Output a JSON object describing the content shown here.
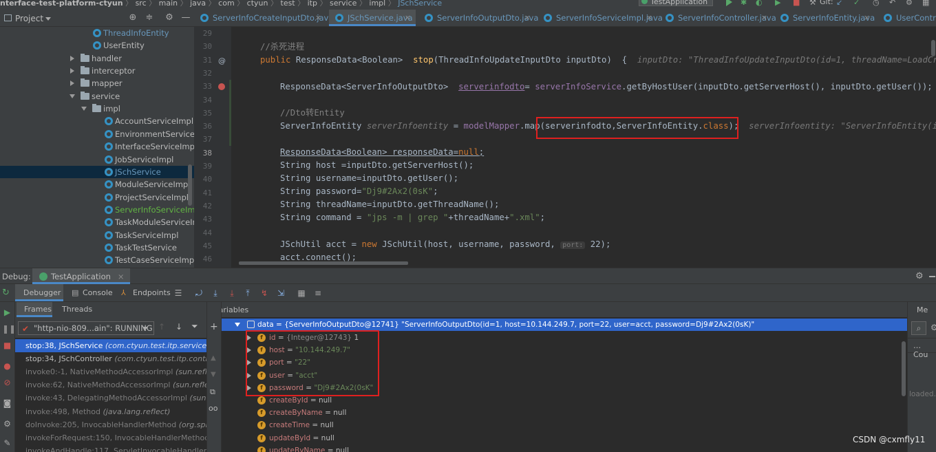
{
  "breadcrumbs": [
    "nterface-test-platform-ctyun",
    "src",
    "main",
    "java",
    "com",
    "ctyun",
    "test",
    "itp",
    "service",
    "impl",
    "JSchService"
  ],
  "run_config": "TestApplication",
  "vcs_label": "Git:",
  "project_panel": {
    "title": "Project",
    "tree": [
      {
        "label": "ThreadInfoEntity",
        "kind": "class",
        "color": "blue"
      },
      {
        "label": "UserEntity",
        "kind": "class",
        "color": "normal"
      },
      {
        "label": "handler",
        "kind": "folder",
        "expanded": false
      },
      {
        "label": "interceptor",
        "kind": "folder",
        "expanded": false
      },
      {
        "label": "mapper",
        "kind": "folder",
        "expanded": false
      },
      {
        "label": "service",
        "kind": "folder",
        "expanded": true
      },
      {
        "label": "impl",
        "kind": "folder",
        "expanded": true
      },
      {
        "label": "AccountServiceImpl",
        "kind": "class",
        "color": "normal"
      },
      {
        "label": "EnvironmentServiceImpl",
        "kind": "class",
        "color": "normal"
      },
      {
        "label": "InterfaceServiceImpl",
        "kind": "class",
        "color": "normal"
      },
      {
        "label": "JobServiceImpl",
        "kind": "class",
        "color": "normal"
      },
      {
        "label": "JSchService",
        "kind": "class",
        "color": "blue",
        "selected": true
      },
      {
        "label": "ModuleServiceImpl",
        "kind": "class",
        "color": "normal"
      },
      {
        "label": "ProjectServiceImpl",
        "kind": "class",
        "color": "normal"
      },
      {
        "label": "ServerInfoServiceImpl",
        "kind": "class",
        "color": "green"
      },
      {
        "label": "TaskModuleServiceImpl",
        "kind": "class",
        "color": "normal"
      },
      {
        "label": "TaskServiceImpl",
        "kind": "class",
        "color": "normal"
      },
      {
        "label": "TaskTestService",
        "kind": "class",
        "color": "normal"
      },
      {
        "label": "TestCaseServiceImpl",
        "kind": "class",
        "color": "normal"
      }
    ]
  },
  "editor_tabs": [
    {
      "label": "ServerInfoCreateInputDto.java",
      "active": false
    },
    {
      "label": "JSchService.java",
      "active": true
    },
    {
      "label": "ServerInfoOutputDto.java",
      "active": false
    },
    {
      "label": "ServerInfoServiceImpl.java",
      "active": false
    },
    {
      "label": "ServerInfoController.java",
      "active": false
    },
    {
      "label": "ServerInfoEntity.java",
      "active": false
    },
    {
      "label": "UserContro",
      "active": false
    }
  ],
  "line_numbers": [
    "29",
    "30",
    "31",
    "32",
    "33",
    "34",
    "35",
    "36",
    "37",
    "38",
    "39",
    "40",
    "41",
    "42",
    "43",
    "44",
    "45",
    "46"
  ],
  "current_line": "38",
  "code": {
    "l30": "//杀死进程",
    "l31": {
      "kw": "public ",
      "type": "ResponseData<Boolean>  ",
      "fn": "stop",
      "rest": "(ThreadInfoUpdateInputDto inputDto)  {",
      "hint": "inputDto: \"ThreadInfoUpdateInputDto(id=1, threadName=LoadCr"
    },
    "l33": {
      "a": "ResponseData<ServerInfoOutputDto>  ",
      "var": "serverinfodto",
      "b": "= ",
      "field": "serverInfoService",
      "c": ".getByHostUser(inputDto.getServerHost(), inputDto.getUser());"
    },
    "l35": "//Dto转Entity",
    "l36": {
      "a": "ServerInfoEntity ",
      "var": "serverInfoentity",
      "b": " = ",
      "field": "modelMapper",
      "c": ".map(serverinfodto,ServerInfoEntity.",
      "kw": "class",
      "d": ");",
      "hint": "serverInfoentity: \"ServerInfoEntity(i"
    },
    "l38": {
      "a": "ResponseData<Boolean> responseData=",
      "kw": "null",
      "b": ";"
    },
    "l39": "String host =inputDto.getServerHost();",
    "l40": "String username=inputDto.getUser();",
    "l41": {
      "a": "String password=",
      "str": "\"Dj9#2Ax2(0sK\"",
      "b": ";"
    },
    "l42": "String threadName=inputDto.getThreadName();",
    "l43": {
      "a": "String command = ",
      "s1": "\"jps -m | grep \"",
      "b": "+threadName+",
      "s2": "\".xml\"",
      "c": ";"
    },
    "l45": {
      "a": "JSchUtil acct = ",
      "kw": "new ",
      "b": "JSchUtil(host, username, password, ",
      "param": "port:",
      "c": " 22);"
    },
    "l46": "acct.connect();"
  },
  "debug": {
    "label": "Debug:",
    "run_tab": "TestApplication",
    "tabs": {
      "debugger": "Debugger",
      "console": "Console",
      "endpoints": "Endpoints"
    },
    "subtabs": {
      "frames": "Frames",
      "threads": "Threads"
    },
    "thread": "\"http-nio-809...ain\": RUNNING",
    "frames": [
      {
        "method": "stop:38, JSchService",
        "cls": "(com.ctyun.test.itp.service.impl)",
        "state": "selected"
      },
      {
        "method": "stop:34, JSchController",
        "cls": "(com.ctyun.test.itp.controller)",
        "state": "normal"
      },
      {
        "method": "invoke0:-1, NativeMethodAccessorImpl",
        "cls": "(sun.reflect)",
        "state": "dim"
      },
      {
        "method": "invoke:62, NativeMethodAccessorImpl",
        "cls": "(sun.reflect)",
        "state": "dim"
      },
      {
        "method": "invoke:43, DelegatingMethodAccessorImpl",
        "cls": "(sun.refle",
        "state": "dim"
      },
      {
        "method": "invoke:498, Method",
        "cls": "(java.lang.reflect)",
        "state": "dim"
      },
      {
        "method": "doInvoke:205, InvocableHandlerMethod",
        "cls": "(org.springf",
        "state": "dim"
      },
      {
        "method": "invokeForRequest:150, InvocableHandlerMethod",
        "cls": "(or",
        "state": "dim"
      },
      {
        "method": "invokeAndHandle:117, ServletInvocableHandlerMeth",
        "cls": "",
        "state": "dim"
      }
    ],
    "variables_title": "Variables",
    "root_var": {
      "name": "data",
      "value": " = {ServerInfoOutputDto@12741} \"ServerInfoOutputDto(id=1, host=10.144.249.7, port=22, user=acct, password=Dj9#2Ax2(0sK)\""
    },
    "fields": [
      {
        "name": "id",
        "eq": " = ",
        "meta": "{Integer@12743} ",
        "value": "1",
        "expandable": true,
        "is_str": false
      },
      {
        "name": "host",
        "eq": " = ",
        "meta": "",
        "value": "\"10.144.249.7\"",
        "expandable": true,
        "is_str": true
      },
      {
        "name": "port",
        "eq": " = ",
        "meta": "",
        "value": "\"22\"",
        "expandable": true,
        "is_str": true
      },
      {
        "name": "user",
        "eq": " = ",
        "meta": "",
        "value": "\"acct\"",
        "expandable": true,
        "is_str": true
      },
      {
        "name": "password",
        "eq": " = ",
        "meta": "",
        "value": "\"Dj9#2Ax2(0sK\"",
        "expandable": true,
        "is_str": true
      },
      {
        "name": "createById",
        "eq": " = ",
        "meta": "",
        "value": "null",
        "expandable": false,
        "is_str": false
      },
      {
        "name": "createByName",
        "eq": " = ",
        "meta": "",
        "value": "null",
        "expandable": false,
        "is_str": false
      },
      {
        "name": "createTime",
        "eq": " = ",
        "meta": "",
        "value": "null",
        "expandable": false,
        "is_str": false
      },
      {
        "name": "updateById",
        "eq": " = ",
        "meta": "",
        "value": "null",
        "expandable": false,
        "is_str": false
      },
      {
        "name": "updateByName",
        "eq": " = ",
        "meta": "",
        "value": "null",
        "expandable": false,
        "is_str": false
      }
    ],
    "watch": {
      "title": "Me",
      "item": "Cou",
      "note": "loaded."
    }
  },
  "watermark": "CSDN @cxmfly11",
  "colors": {
    "selection": "#2f65ca",
    "highlight_box": "#e0201f",
    "exec_line": "#2d6099",
    "breakpoint": "#c75450"
  }
}
